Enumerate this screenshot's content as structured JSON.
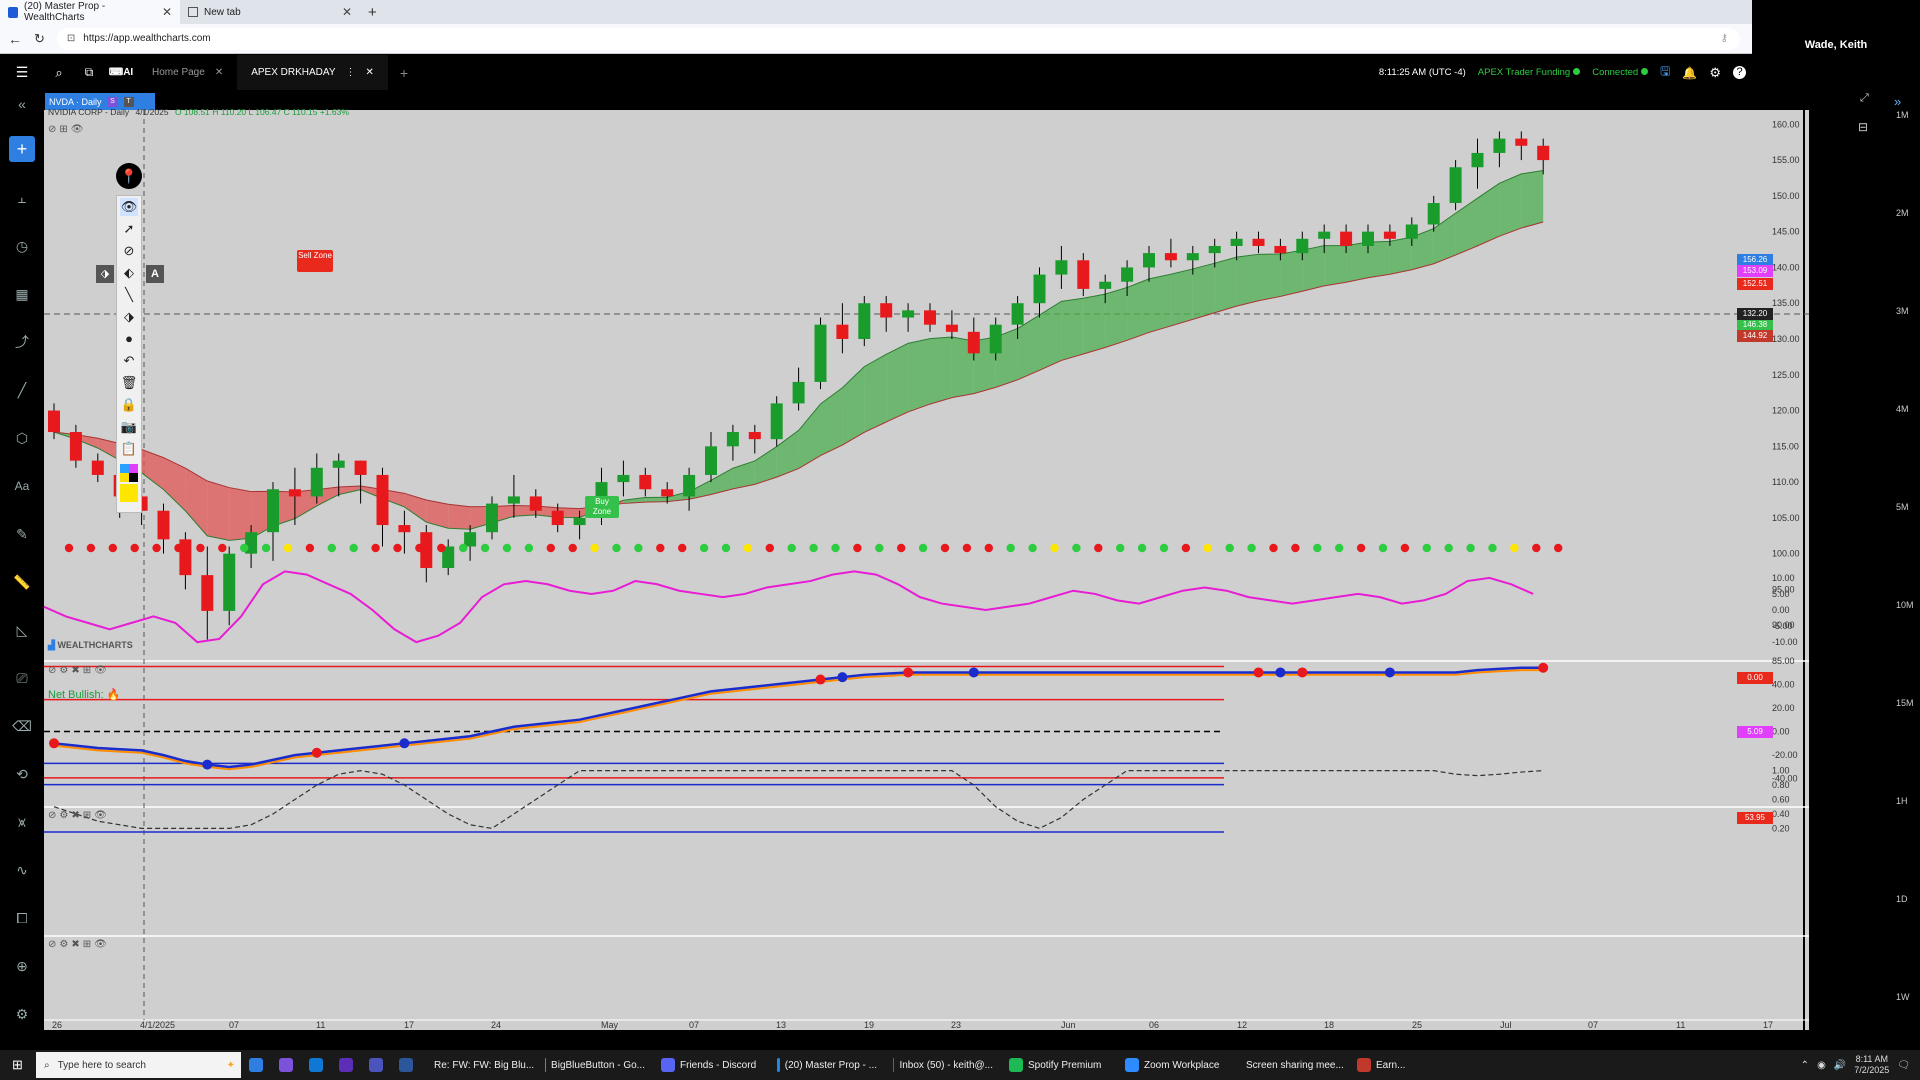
{
  "browser": {
    "tabs": [
      {
        "title": "(20) Master Prop - WealthCharts"
      },
      {
        "title": "New tab"
      }
    ],
    "url": "https://app.wealthcharts.com"
  },
  "zoom_panel": {
    "participant": "Wade, Keith"
  },
  "app": {
    "tabs": [
      {
        "label": "Home Page"
      },
      {
        "label": "APEX DRKHADAY"
      }
    ],
    "time": "8:11:25 AM",
    "timezone": "(UTC -4)",
    "account": "APEX Trader Funding",
    "connection": "Connected"
  },
  "chart": {
    "symbol_tag": "NVDA · Daily",
    "legend": "NVIDIA CORP - Daily",
    "legend_date": "4/1/2025",
    "legend_values": "O 108.51  H 110.20  L 106.47  C 110.15  +1.63%",
    "watermark": "WEALTHCHARTS",
    "sell_label": "Sell Zone",
    "buy_label": "Buy Zone",
    "net_bullish": "Net Bullish:",
    "price_axis": [
      "160.00",
      "155.00",
      "150.00",
      "145.00",
      "140.00",
      "135.00",
      "130.00",
      "125.00",
      "120.00",
      "115.00",
      "110.00",
      "105.00",
      "100.00",
      "95.00",
      "90.00",
      "85.00"
    ],
    "price_badges": {
      "b1": "156.26",
      "b2": "153.09",
      "b3": "152.51",
      "b4": "146.38",
      "b5": "144.92",
      "cross": "132.20"
    },
    "osc1_axis": [
      "10.00",
      "5.00",
      "0.00",
      "-5.00",
      "-10.00"
    ],
    "osc1_value": "5.09",
    "dots_value": "0.00",
    "osc2_axis": [
      "40.00",
      "20.00",
      "0.00",
      "-20.00",
      "-40.00"
    ],
    "osc2_value": "53.95",
    "osc3_axis": [
      "1.00",
      "0.80",
      "0.60",
      "0.40",
      "0.20"
    ],
    "date_axis": [
      {
        "t": "26",
        "x": 52
      },
      {
        "t": "4/1/2025",
        "x": 140
      },
      {
        "t": "07",
        "x": 229
      },
      {
        "t": "11",
        "x": 316
      },
      {
        "t": "17",
        "x": 404
      },
      {
        "t": "24",
        "x": 491
      },
      {
        "t": "May",
        "x": 601
      },
      {
        "t": "07",
        "x": 689
      },
      {
        "t": "13",
        "x": 776
      },
      {
        "t": "19",
        "x": 864
      },
      {
        "t": "23",
        "x": 951
      },
      {
        "t": "Jun",
        "x": 1061
      },
      {
        "t": "06",
        "x": 1149
      },
      {
        "t": "12",
        "x": 1237
      },
      {
        "t": "18",
        "x": 1324
      },
      {
        "t": "25",
        "x": 1412
      },
      {
        "t": "Jul",
        "x": 1500
      },
      {
        "t": "07",
        "x": 1588
      },
      {
        "t": "11",
        "x": 1676
      },
      {
        "t": "17",
        "x": 1763
      }
    ],
    "volume_axis": [
      "1M",
      "2M",
      "3M",
      "4M",
      "5M",
      "10M",
      "15M",
      "1H",
      "1D",
      "1W"
    ],
    "chart_data": {
      "type": "candlestick",
      "x_start": "2025-03-26",
      "candles": [
        [
          120,
          121,
          116,
          117
        ],
        [
          117,
          118,
          112,
          113
        ],
        [
          113,
          114,
          110,
          111
        ],
        [
          111,
          112,
          105,
          108
        ],
        [
          108,
          110,
          104,
          106
        ],
        [
          106,
          107,
          100,
          102
        ],
        [
          102,
          103,
          95,
          97
        ],
        [
          97,
          101,
          88,
          92
        ],
        [
          92,
          101,
          90,
          100
        ],
        [
          100,
          104,
          98,
          103
        ],
        [
          103,
          110,
          99,
          109
        ],
        [
          109,
          112,
          104,
          108
        ],
        [
          108,
          114,
          107,
          112
        ],
        [
          112,
          114,
          108,
          113
        ],
        [
          113,
          113,
          107,
          111
        ],
        [
          111,
          112,
          101,
          104
        ],
        [
          104,
          106,
          100,
          103
        ],
        [
          103,
          104,
          96,
          98
        ],
        [
          98,
          102,
          97,
          101
        ],
        [
          101,
          104,
          99,
          103
        ],
        [
          103,
          108,
          102,
          107
        ],
        [
          107,
          111,
          105,
          108
        ],
        [
          108,
          109,
          105,
          106
        ],
        [
          106,
          107,
          103,
          104
        ],
        [
          104,
          106,
          102,
          105
        ],
        [
          105,
          112,
          104,
          110
        ],
        [
          110,
          113,
          108,
          111
        ],
        [
          111,
          112,
          108,
          109
        ],
        [
          109,
          110,
          107,
          108
        ],
        [
          108,
          112,
          106,
          111
        ],
        [
          111,
          117,
          110,
          115
        ],
        [
          115,
          118,
          113,
          117
        ],
        [
          117,
          118,
          114,
          116
        ],
        [
          116,
          122,
          115,
          121
        ],
        [
          121,
          126,
          120,
          124
        ],
        [
          124,
          133,
          123,
          132
        ],
        [
          132,
          135,
          128,
          130
        ],
        [
          130,
          136,
          129,
          135
        ],
        [
          135,
          136,
          131,
          133
        ],
        [
          133,
          135,
          131,
          134
        ],
        [
          134,
          135,
          131,
          132
        ],
        [
          132,
          134,
          130,
          131
        ],
        [
          131,
          133,
          127,
          128
        ],
        [
          128,
          133,
          127,
          132
        ],
        [
          132,
          136,
          130,
          135
        ],
        [
          135,
          140,
          133,
          139
        ],
        [
          139,
          143,
          137,
          141
        ],
        [
          141,
          142,
          136,
          137
        ],
        [
          137,
          139,
          135,
          138
        ],
        [
          138,
          141,
          136,
          140
        ],
        [
          140,
          143,
          138,
          142
        ],
        [
          142,
          144,
          140,
          141
        ],
        [
          141,
          143,
          139,
          142
        ],
        [
          142,
          144,
          140,
          143
        ],
        [
          143,
          145,
          141,
          144
        ],
        [
          144,
          145,
          142,
          143
        ],
        [
          143,
          144,
          141,
          142
        ],
        [
          142,
          145,
          141,
          144
        ],
        [
          144,
          146,
          142,
          145
        ],
        [
          145,
          146,
          142,
          143
        ],
        [
          143,
          146,
          142,
          145
        ],
        [
          145,
          146,
          143,
          144
        ],
        [
          144,
          147,
          143,
          146
        ],
        [
          146,
          150,
          145,
          149
        ],
        [
          149,
          155,
          148,
          154
        ],
        [
          154,
          158,
          151,
          156
        ],
        [
          156,
          159,
          154,
          158
        ],
        [
          158,
          159,
          155,
          157
        ],
        [
          157,
          158,
          153,
          155
        ]
      ],
      "ylim": [
        85,
        162
      ],
      "osc1": [
        1,
        -2,
        -4,
        -6,
        -4,
        -2,
        -4,
        -10,
        -9,
        -2,
        8,
        12,
        11,
        8,
        5,
        0,
        -6,
        -10,
        -8,
        -4,
        4,
        8,
        9,
        8,
        6,
        5,
        6,
        9,
        8,
        6,
        5,
        4,
        5,
        7,
        8,
        9,
        11,
        12,
        11,
        8,
        4,
        2,
        1,
        0,
        1,
        2,
        4,
        6,
        5,
        3,
        2,
        4,
        6,
        7,
        6,
        4,
        3,
        2,
        3,
        4,
        5,
        4,
        2,
        3,
        5,
        9,
        10,
        8,
        5
      ],
      "osc2": [
        -10,
        -12,
        -14,
        -15,
        -16,
        -20,
        -25,
        -28,
        -30,
        -28,
        -24,
        -20,
        -18,
        -16,
        -14,
        -12,
        -10,
        -8,
        -6,
        -4,
        0,
        4,
        6,
        8,
        10,
        14,
        18,
        22,
        26,
        30,
        34,
        36,
        38,
        40,
        42,
        44,
        46,
        48,
        49,
        50,
        50,
        50,
        50,
        50,
        50,
        50,
        50,
        50,
        50,
        50,
        50,
        50,
        50,
        50,
        50,
        50,
        50,
        50,
        50,
        50,
        50,
        50,
        50,
        50,
        50,
        52,
        53,
        54,
        54
      ],
      "osc3": [
        0.5,
        0.4,
        0.3,
        0.25,
        0.2,
        0.2,
        0.2,
        0.2,
        0.2,
        0.25,
        0.4,
        0.6,
        0.8,
        0.95,
        1,
        0.95,
        0.8,
        0.6,
        0.4,
        0.25,
        0.2,
        0.4,
        0.6,
        0.8,
        1,
        1,
        1,
        1,
        1,
        1,
        1,
        1,
        1,
        1,
        1,
        1,
        1,
        1,
        1,
        1,
        1,
        1,
        0.8,
        0.5,
        0.3,
        0.2,
        0.35,
        0.6,
        0.8,
        1,
        1,
        1,
        1,
        1,
        1,
        1,
        1,
        1,
        1,
        1,
        1,
        1,
        1,
        1,
        0.95,
        0.93,
        0.95,
        0.98,
        1
      ]
    }
  },
  "taskbar": {
    "search_placeholder": "Type here to search",
    "items": [
      {
        "label": "Re: FW: FW: Big Blu...",
        "color": "#e84a3c"
      },
      {
        "label": "BigBlueButton - Go...",
        "color": "#4285f4"
      },
      {
        "label": "Friends - Discord",
        "color": "#5865f2"
      },
      {
        "label": "(20) Master Prop - ...",
        "color": "#1e88e5"
      },
      {
        "label": "Inbox (50) - keith@...",
        "color": "#0f78d4"
      },
      {
        "label": "Spotify Premium",
        "color": "#1db954"
      },
      {
        "label": "Zoom Workplace",
        "color": "#2d8cff"
      },
      {
        "label": "Screen sharing mee...",
        "color": "#2d8cff"
      },
      {
        "label": "Earn...",
        "color": "#c0392b"
      }
    ],
    "clock_time": "8:11 AM",
    "clock_date": "7/2/2025"
  }
}
